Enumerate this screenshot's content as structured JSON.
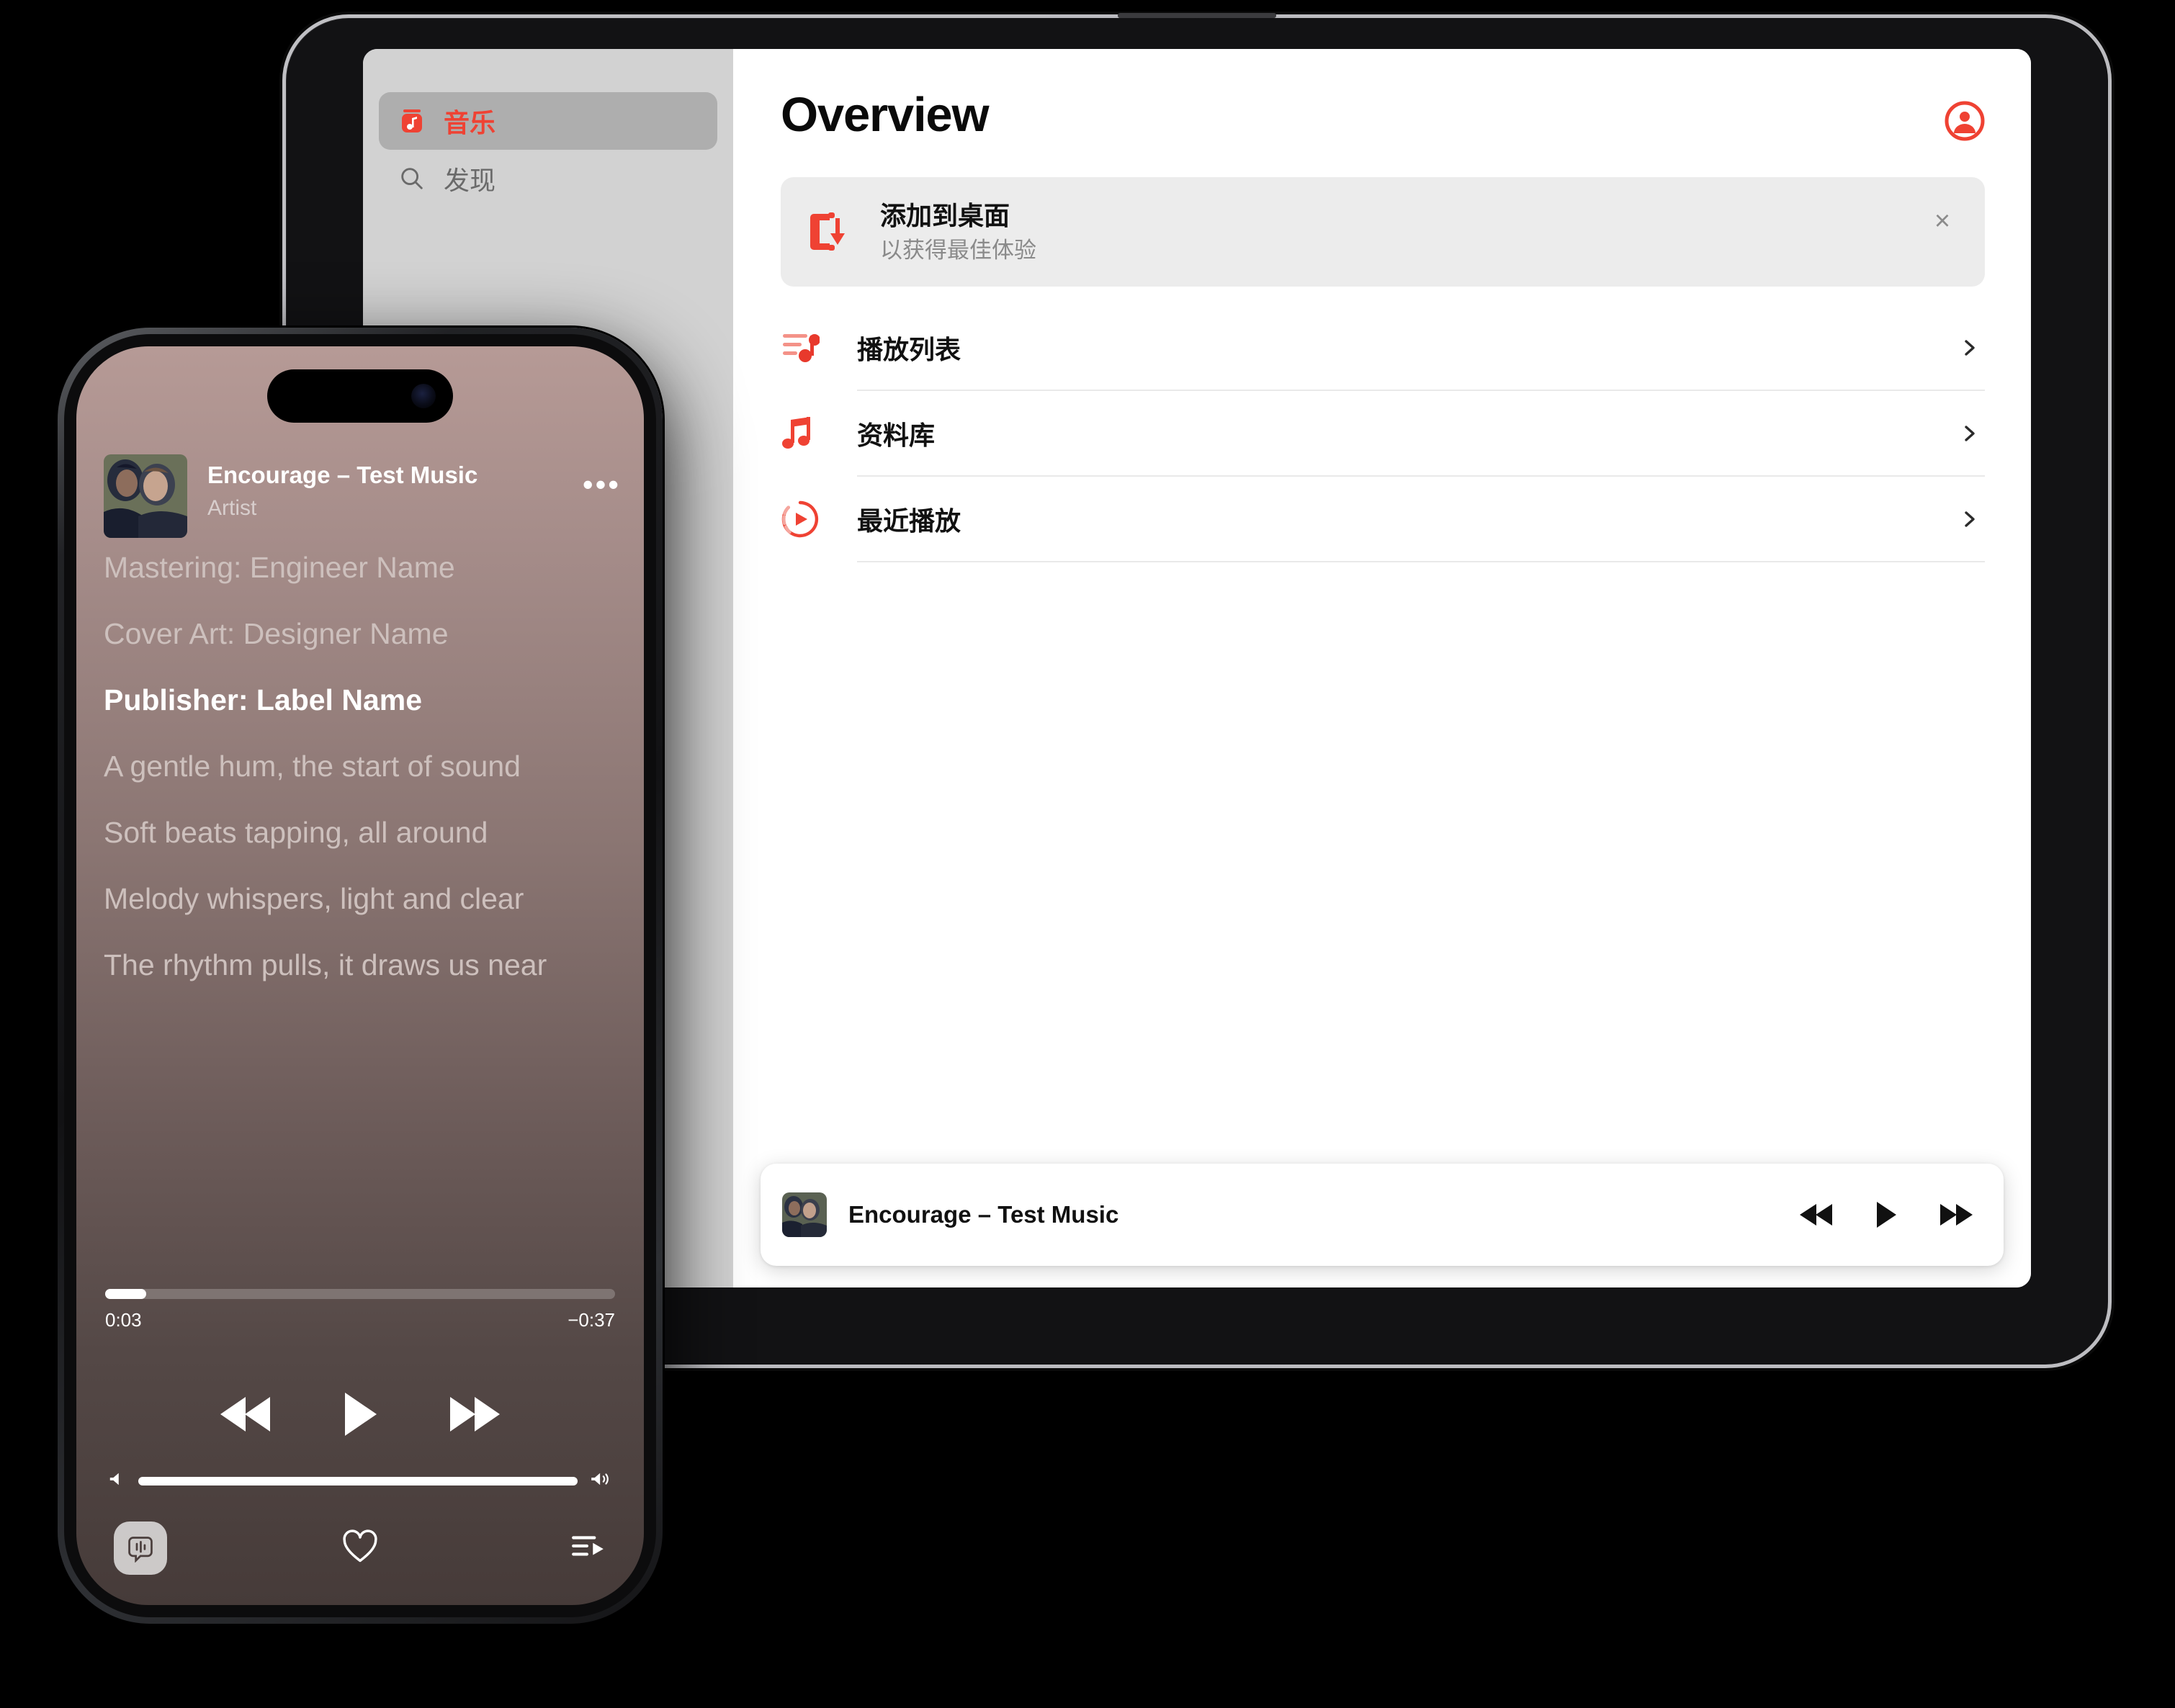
{
  "tablet": {
    "sidebar": {
      "items": [
        {
          "label": "音乐",
          "icon": "music-app-icon",
          "active": true
        },
        {
          "label": "发现",
          "icon": "search-icon",
          "active": false
        }
      ]
    },
    "main": {
      "page_title": "Overview",
      "account_icon": "account-circle-icon",
      "promo": {
        "icon": "add-to-home-screen-icon",
        "title": "添加到桌面",
        "subtitle": "以获得最佳体验",
        "close_icon": "close-icon"
      },
      "nav_rows": [
        {
          "label": "播放列表",
          "icon": "playlist-note-icon",
          "chevron": "chevron-right-icon"
        },
        {
          "label": "资料库",
          "icon": "music-note-icon",
          "chevron": "chevron-right-icon"
        },
        {
          "label": "最近播放",
          "icon": "recent-play-icon",
          "chevron": "chevron-right-icon"
        }
      ]
    },
    "player": {
      "track": "Encourage – Test Music",
      "artwork": "album-art-two-men",
      "controls": [
        {
          "name": "rewind-button",
          "icon": "rewind-icon"
        },
        {
          "name": "play-button",
          "icon": "play-icon"
        },
        {
          "name": "fast-forward-button",
          "icon": "fast-forward-icon"
        }
      ]
    }
  },
  "phone": {
    "now_playing": {
      "artwork": "album-art-two-men",
      "track": "Encourage – Test Music",
      "artist": "Artist",
      "more_label": "•••"
    },
    "lyrics": [
      {
        "text": "Mastering: Engineer Name",
        "state": "dim"
      },
      {
        "text": "Cover Art: Designer Name",
        "state": "dim"
      },
      {
        "text": "Publisher: Label Name",
        "state": "current"
      },
      {
        "text": "A gentle hum, the start of sound",
        "state": "dim"
      },
      {
        "text": "Soft beats tapping, all around",
        "state": "dim"
      },
      {
        "text": "Melody whispers, light and clear",
        "state": "dim"
      },
      {
        "text": "The rhythm pulls, it draws us near",
        "state": "dim"
      }
    ],
    "progress": {
      "elapsed": "0:03",
      "remaining": "−0:37",
      "percent": 8
    },
    "transport": [
      {
        "name": "rewind-button",
        "icon": "rewind-icon"
      },
      {
        "name": "play-button",
        "icon": "play-icon"
      },
      {
        "name": "fast-forward-button",
        "icon": "fast-forward-icon"
      }
    ],
    "volume": {
      "min_icon": "volume-low-icon",
      "max_icon": "volume-high-icon",
      "percent": 100
    },
    "tabs": [
      {
        "name": "lyrics-tab",
        "icon": "lyrics-bubble-icon",
        "active": true
      },
      {
        "name": "favorite-tab",
        "icon": "heart-icon",
        "active": false
      },
      {
        "name": "queue-tab",
        "icon": "queue-list-icon",
        "active": false
      }
    ]
  },
  "colors": {
    "accent_red": "#ef4233",
    "promo_bg": "#ececec",
    "sidebar_bg": "#d2d2d2",
    "phone_gradient_top": "#b69a96",
    "phone_gradient_bottom": "#463b39"
  }
}
